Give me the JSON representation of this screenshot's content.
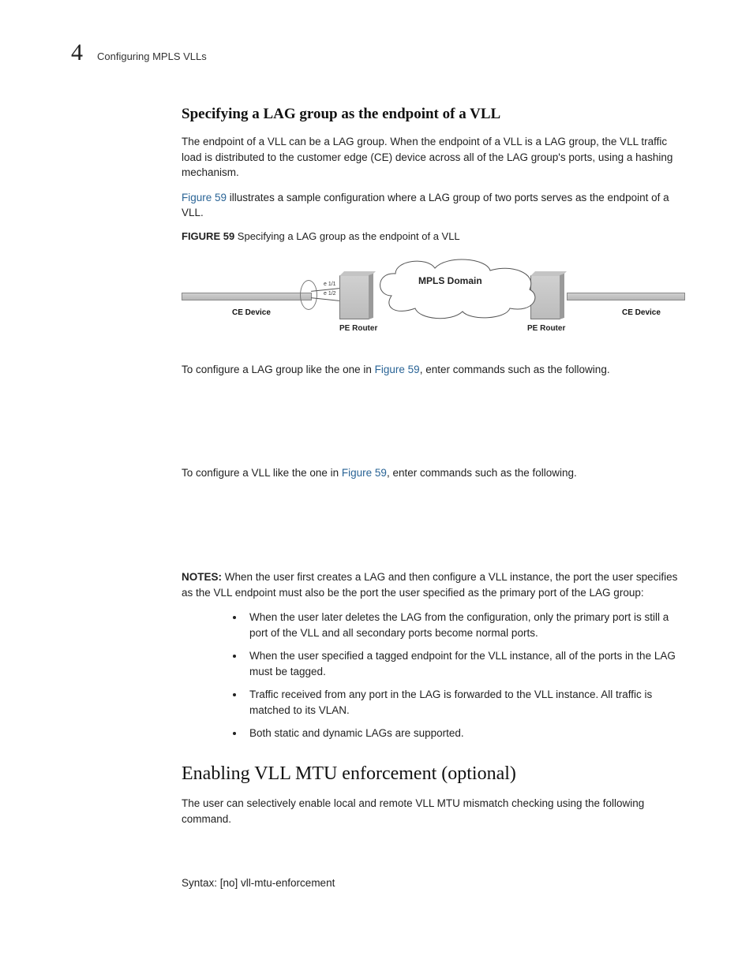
{
  "header": {
    "chapter_number": "4",
    "running_title": "Configuring MPLS VLLs"
  },
  "section1": {
    "heading": "Specifying a LAG group as the endpoint of a VLL",
    "para1": "The endpoint of a VLL can be a LAG group. When the endpoint of a VLL is a LAG group, the VLL traffic load is distributed to the customer edge (CE) device across all of the LAG group's ports, using a hashing mechanism.",
    "para2_pre": "",
    "para2_link": "Figure 59",
    "para2_post": " illustrates a sample configuration where a LAG group of two ports serves as the endpoint of a VLL.",
    "figure_caption_lead": "FIGURE 59",
    "figure_caption_text": " Specifying a LAG group as the endpoint of a VLL",
    "diagram": {
      "port1": "e 1/1",
      "port2": "e 1/2",
      "ce_device": "CE Device",
      "pe_router": "PE Router",
      "mpls": "MPLS Domain"
    },
    "para3_pre": "To configure a LAG group like the one in ",
    "para3_link": "Figure 59",
    "para3_post": ", enter commands such as the following.",
    "para4_pre": "To configure a VLL like the one in ",
    "para4_link": "Figure 59",
    "para4_post": ", enter commands such as the following.",
    "notes_lead": "NOTES:",
    "notes_intro": "   When the user first creates a LAG and then configure a VLL instance, the port the user specifies as the VLL endpoint must also be the port the user specified as the primary port of the LAG group:",
    "bullets": [
      "When the user later deletes the LAG from the configuration, only the primary port is still a port of the VLL and all secondary ports become normal ports.",
      "When the user specified a tagged endpoint for the VLL instance, all of the ports in the LAG must be tagged.",
      "Traffic received from any port in the LAG is forwarded to the VLL instance. All traffic is matched to its VLAN.",
      "Both static and dynamic LAGs are supported."
    ]
  },
  "section2": {
    "heading": "Enabling VLL MTU enforcement (optional)",
    "para1": "The user can selectively enable local and remote VLL MTU mismatch checking using the following command.",
    "syntax": "Syntax:  [no] vll-mtu-enforcement"
  }
}
